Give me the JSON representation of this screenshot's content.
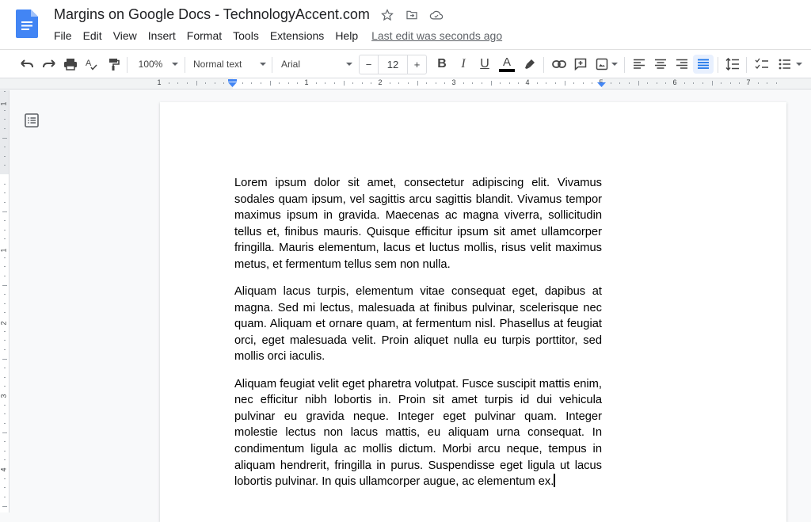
{
  "app": {
    "name": "Google Docs",
    "document_title": "Margins on Google Docs - TechnologyAccent.com",
    "title_icons": [
      "star-icon",
      "move-to-folder-icon",
      "cloud-saved-icon"
    ]
  },
  "menu": {
    "items": [
      "File",
      "Edit",
      "View",
      "Insert",
      "Format",
      "Tools",
      "Extensions",
      "Help"
    ],
    "last_edit": "Last edit was seconds ago"
  },
  "toolbar": {
    "zoom": "100%",
    "style": "Normal text",
    "font": "Arial",
    "font_size": "12",
    "decrease_label": "−",
    "increase_label": "+",
    "bold_label": "B",
    "italic_label": "I",
    "underline_label": "U",
    "text_color_label": "A",
    "text_color": "#000000",
    "active_alignment": "justify",
    "accent_color": "#1a73e8"
  },
  "ruler": {
    "numbers": [
      "1",
      "1",
      "2",
      "3",
      "4",
      "5",
      "6",
      "7"
    ],
    "vertical_numbers": [
      "1",
      "1",
      "2",
      "3",
      "4"
    ]
  },
  "document": {
    "paragraphs": [
      "Lorem ipsum dolor sit amet, consectetur adipiscing elit. Vivamus sodales quam ipsum, vel sagittis arcu sagittis blandit. Vivamus tempor maximus ipsum in gravida. Maecenas ac magna viverra, sollicitudin tellus et, finibus mauris. Quisque efficitur ipsum sit amet ullamcorper fringilla. Mauris elementum, lacus et luctus mollis, risus velit maximus metus, et fermentum tellus sem non nulla.",
      "Aliquam lacus turpis, elementum vitae consequat eget, dapibus at magna. Sed mi lectus, malesuada at finibus pulvinar, scelerisque nec quam. Aliquam et ornare quam, at fermentum nisl. Phasellus at feugiat orci, eget malesuada velit. Proin aliquet nulla eu turpis porttitor, sed mollis orci iaculis.",
      "Aliquam feugiat velit eget pharetra volutpat. Fusce suscipit mattis enim, nec efficitur nibh lobortis in. Proin sit amet turpis id dui vehicula pulvinar eu gravida neque. Integer eget pulvinar quam. Integer molestie lectus non lacus mattis, eu aliquam urna consequat. In condimentum ligula ac mollis dictum. Morbi arcu neque, tempus in aliquam hendrerit, fringilla in purus. Suspendisse eget ligula ut lacus lobortis pulvinar. In quis ullamcorper augue, ac elementum ex."
    ]
  }
}
